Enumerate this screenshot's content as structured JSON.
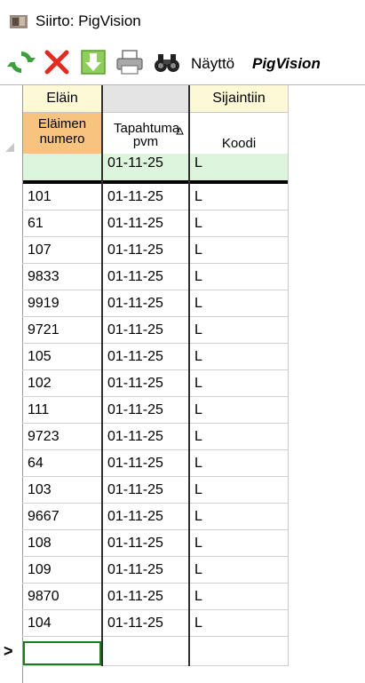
{
  "window": {
    "title": "Siirto: PigVision"
  },
  "toolbar": {
    "display_label": "Näyttö",
    "brand": "PigVision"
  },
  "grid": {
    "group_headers": [
      "Eläin",
      "",
      "Sijaintiin"
    ],
    "column_headers": [
      "Eläimen numero",
      "Tapahtuma pvm",
      "Koodi"
    ],
    "filter_row": {
      "numero": "",
      "pvm": "01-11-25",
      "koodi": "L"
    },
    "rows": [
      {
        "numero": "101",
        "pvm": "01-11-25",
        "koodi": "L"
      },
      {
        "numero": "61",
        "pvm": "01-11-25",
        "koodi": "L"
      },
      {
        "numero": "107",
        "pvm": "01-11-25",
        "koodi": "L"
      },
      {
        "numero": "9833",
        "pvm": "01-11-25",
        "koodi": "L"
      },
      {
        "numero": "9919",
        "pvm": "01-11-25",
        "koodi": "L"
      },
      {
        "numero": "9721",
        "pvm": "01-11-25",
        "koodi": "L"
      },
      {
        "numero": "105",
        "pvm": "01-11-25",
        "koodi": "L"
      },
      {
        "numero": "102",
        "pvm": "01-11-25",
        "koodi": "L"
      },
      {
        "numero": "111",
        "pvm": "01-11-25",
        "koodi": "L"
      },
      {
        "numero": "9723",
        "pvm": "01-11-25",
        "koodi": "L"
      },
      {
        "numero": "64",
        "pvm": "01-11-25",
        "koodi": "L"
      },
      {
        "numero": "103",
        "pvm": "01-11-25",
        "koodi": "L"
      },
      {
        "numero": "9667",
        "pvm": "01-11-25",
        "koodi": "L"
      },
      {
        "numero": "108",
        "pvm": "01-11-25",
        "koodi": "L"
      },
      {
        "numero": "109",
        "pvm": "01-11-25",
        "koodi": "L"
      },
      {
        "numero": "9870",
        "pvm": "01-11-25",
        "koodi": "L"
      },
      {
        "numero": "104",
        "pvm": "01-11-25",
        "koodi": "L"
      }
    ],
    "new_row_marker": ">",
    "colors": {
      "group_header_bg": "#fdf9d6",
      "numero_header_bg": "#f6c47e",
      "filter_row_bg": "#dcf5dc",
      "new_row_border": "#1e7a1e"
    }
  }
}
